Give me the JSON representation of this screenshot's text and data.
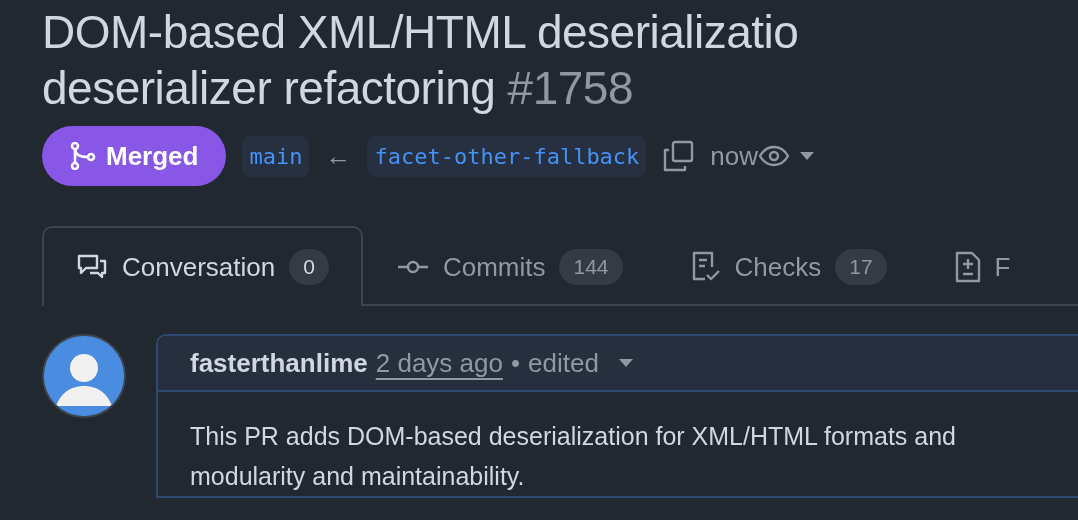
{
  "title": {
    "lines": [
      "DOM-based XML/HTML deserializatio",
      "deserializer refactoring"
    ],
    "number": "#1758"
  },
  "status": {
    "kind": "merged",
    "label": "Merged"
  },
  "branches": {
    "base": "main",
    "arrow": "←",
    "head": "facet-other-fallback",
    "time": "now"
  },
  "tabs": [
    {
      "label": "Conversation",
      "count": "0",
      "kind": "comments",
      "selected": true
    },
    {
      "label": "Commits",
      "count": "144",
      "kind": "commit",
      "selected": false
    },
    {
      "label": "Checks",
      "count": "17",
      "kind": "checklist",
      "selected": false
    },
    {
      "label": "F",
      "kind": "diff",
      "selected": false
    }
  ],
  "comment": {
    "author": "fasterthanlime",
    "time": "2 days ago",
    "separator": "•",
    "edited": "edited",
    "body_lines": [
      "This PR adds DOM-based deserialization for XML/HTML formats and",
      "modularity and maintainability."
    ]
  }
}
